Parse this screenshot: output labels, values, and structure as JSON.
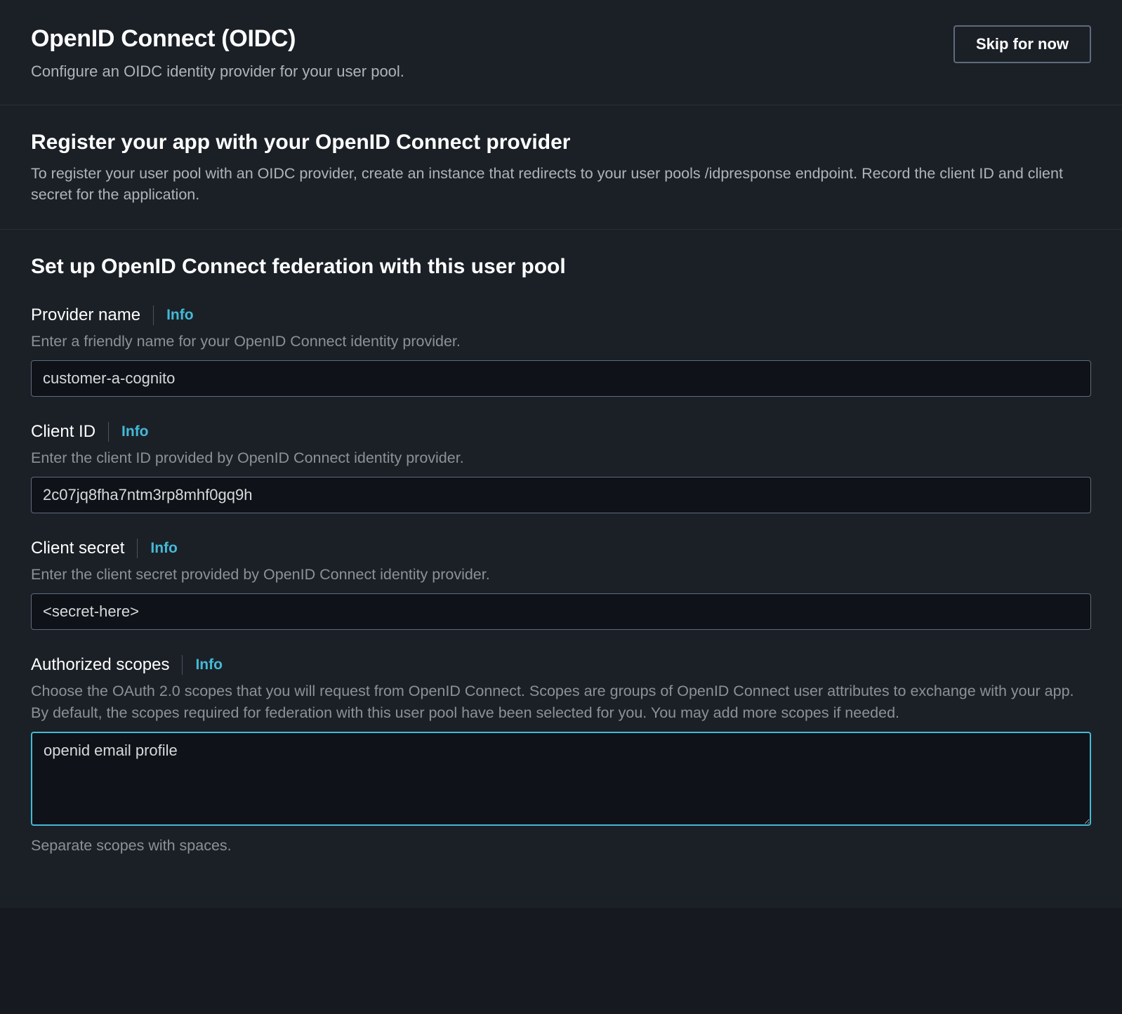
{
  "header": {
    "title": "OpenID Connect (OIDC)",
    "subtitle": "Configure an OIDC identity provider for your user pool.",
    "skip_label": "Skip for now"
  },
  "register_section": {
    "heading": "Register your app with your OpenID Connect provider",
    "description": "To register your user pool with an OIDC provider, create an instance that redirects to your user pools /idpresponse endpoint. Record the client ID and client secret for the application."
  },
  "setup_section": {
    "heading": "Set up OpenID Connect federation with this user pool"
  },
  "info_label": "Info",
  "fields": {
    "provider_name": {
      "label": "Provider name",
      "help": "Enter a friendly name for your OpenID Connect identity provider.",
      "value": "customer-a-cognito"
    },
    "client_id": {
      "label": "Client ID",
      "help": "Enter the client ID provided by OpenID Connect identity provider.",
      "value": "2c07jq8fha7ntm3rp8mhf0gq9h"
    },
    "client_secret": {
      "label": "Client secret",
      "help": "Enter the client secret provided by OpenID Connect identity provider.",
      "value": "<secret-here>"
    },
    "authorized_scopes": {
      "label": "Authorized scopes",
      "help": "Choose the OAuth 2.0 scopes that you will request from OpenID Connect. Scopes are groups of OpenID Connect user attributes to exchange with your app. By default, the scopes required for federation with this user pool have been selected for you. You may add more scopes if needed.",
      "value": "openid email profile",
      "hint": "Separate scopes with spaces."
    }
  }
}
